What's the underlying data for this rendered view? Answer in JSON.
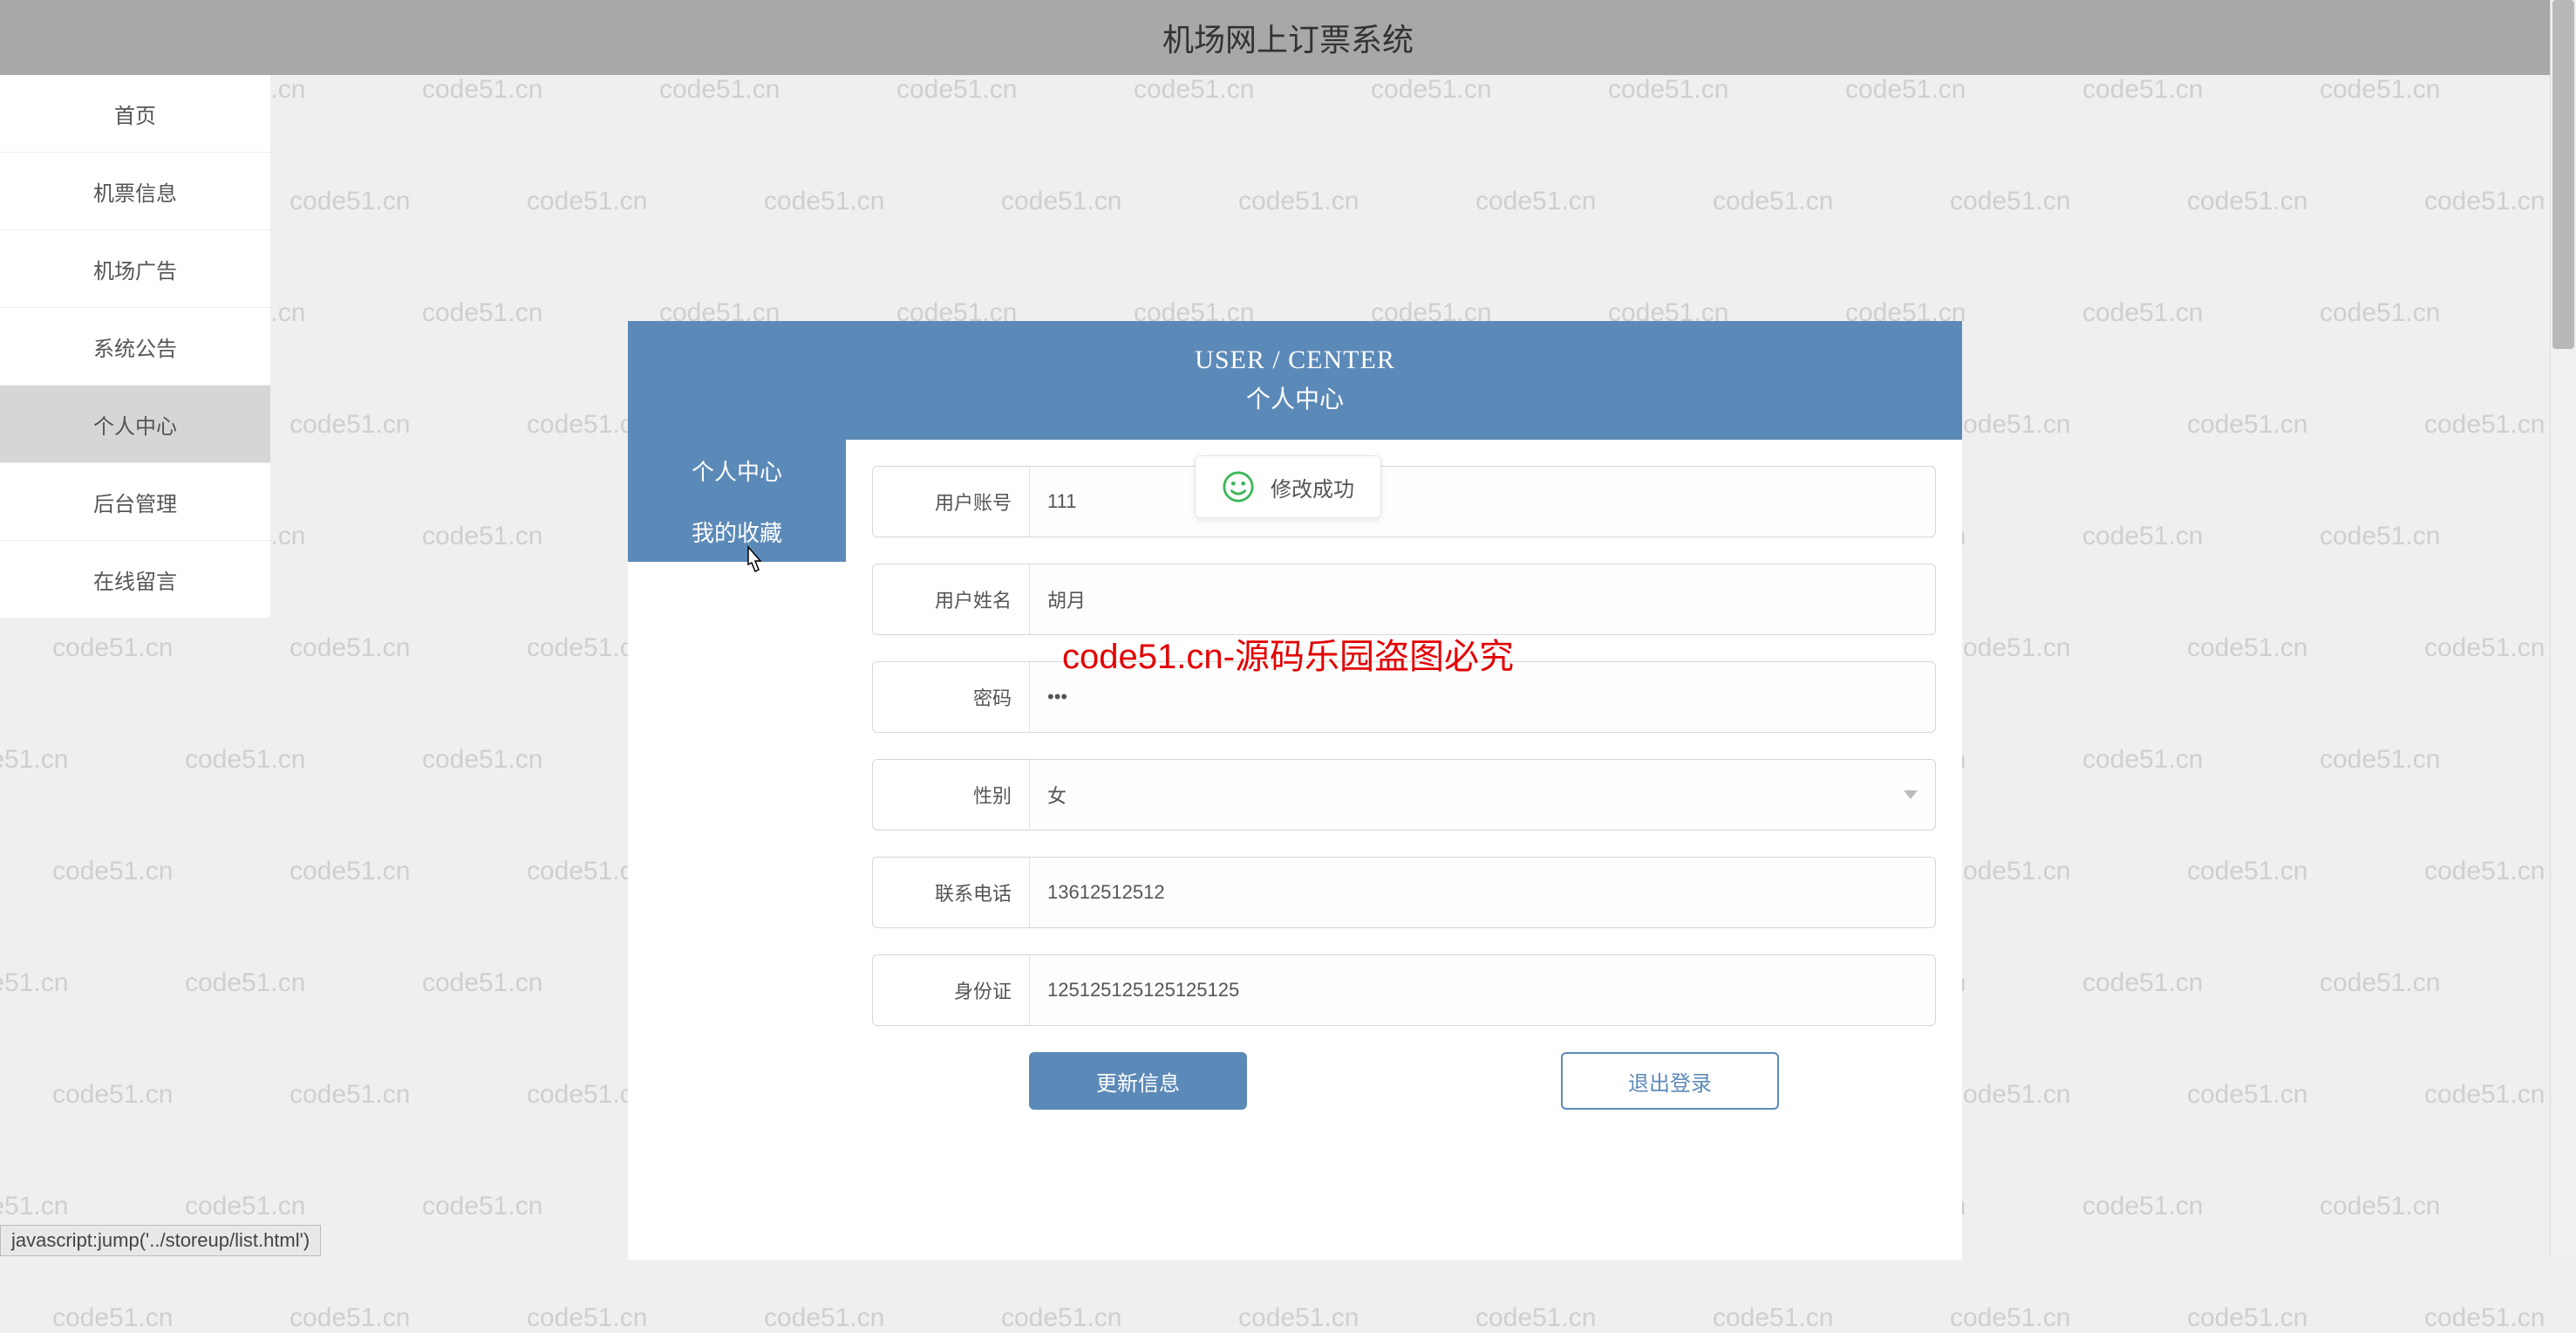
{
  "header": {
    "title": "机场网上订票系统"
  },
  "sidebar": {
    "items": [
      {
        "label": "首页"
      },
      {
        "label": "机票信息"
      },
      {
        "label": "机场广告"
      },
      {
        "label": "系统公告"
      },
      {
        "label": "个人中心"
      },
      {
        "label": "后台管理"
      },
      {
        "label": "在线留言"
      }
    ],
    "active_index": 4
  },
  "panel_header": {
    "en": "USER / CENTER",
    "cn": "个人中心"
  },
  "inner_sidebar": {
    "items": [
      {
        "label": "个人中心"
      },
      {
        "label": "我的收藏"
      }
    ]
  },
  "form": {
    "fields": {
      "account": {
        "label": "用户账号",
        "value": "111"
      },
      "name": {
        "label": "用户姓名",
        "value": "胡月"
      },
      "password": {
        "label": "密码",
        "value": "•••"
      },
      "gender": {
        "label": "性别",
        "value": "女"
      },
      "phone": {
        "label": "联系电话",
        "value": "13612512512"
      },
      "idcard": {
        "label": "身份证",
        "value": "125125125125125125"
      }
    },
    "buttons": {
      "update": "更新信息",
      "logout": "退出登录"
    }
  },
  "toast": {
    "text": "修改成功"
  },
  "overlay_text": "code51.cn-源码乐园盗图必究",
  "status_bar": "javascript:jump('../storeup/list.html')",
  "watermark_text": "code51.cn"
}
